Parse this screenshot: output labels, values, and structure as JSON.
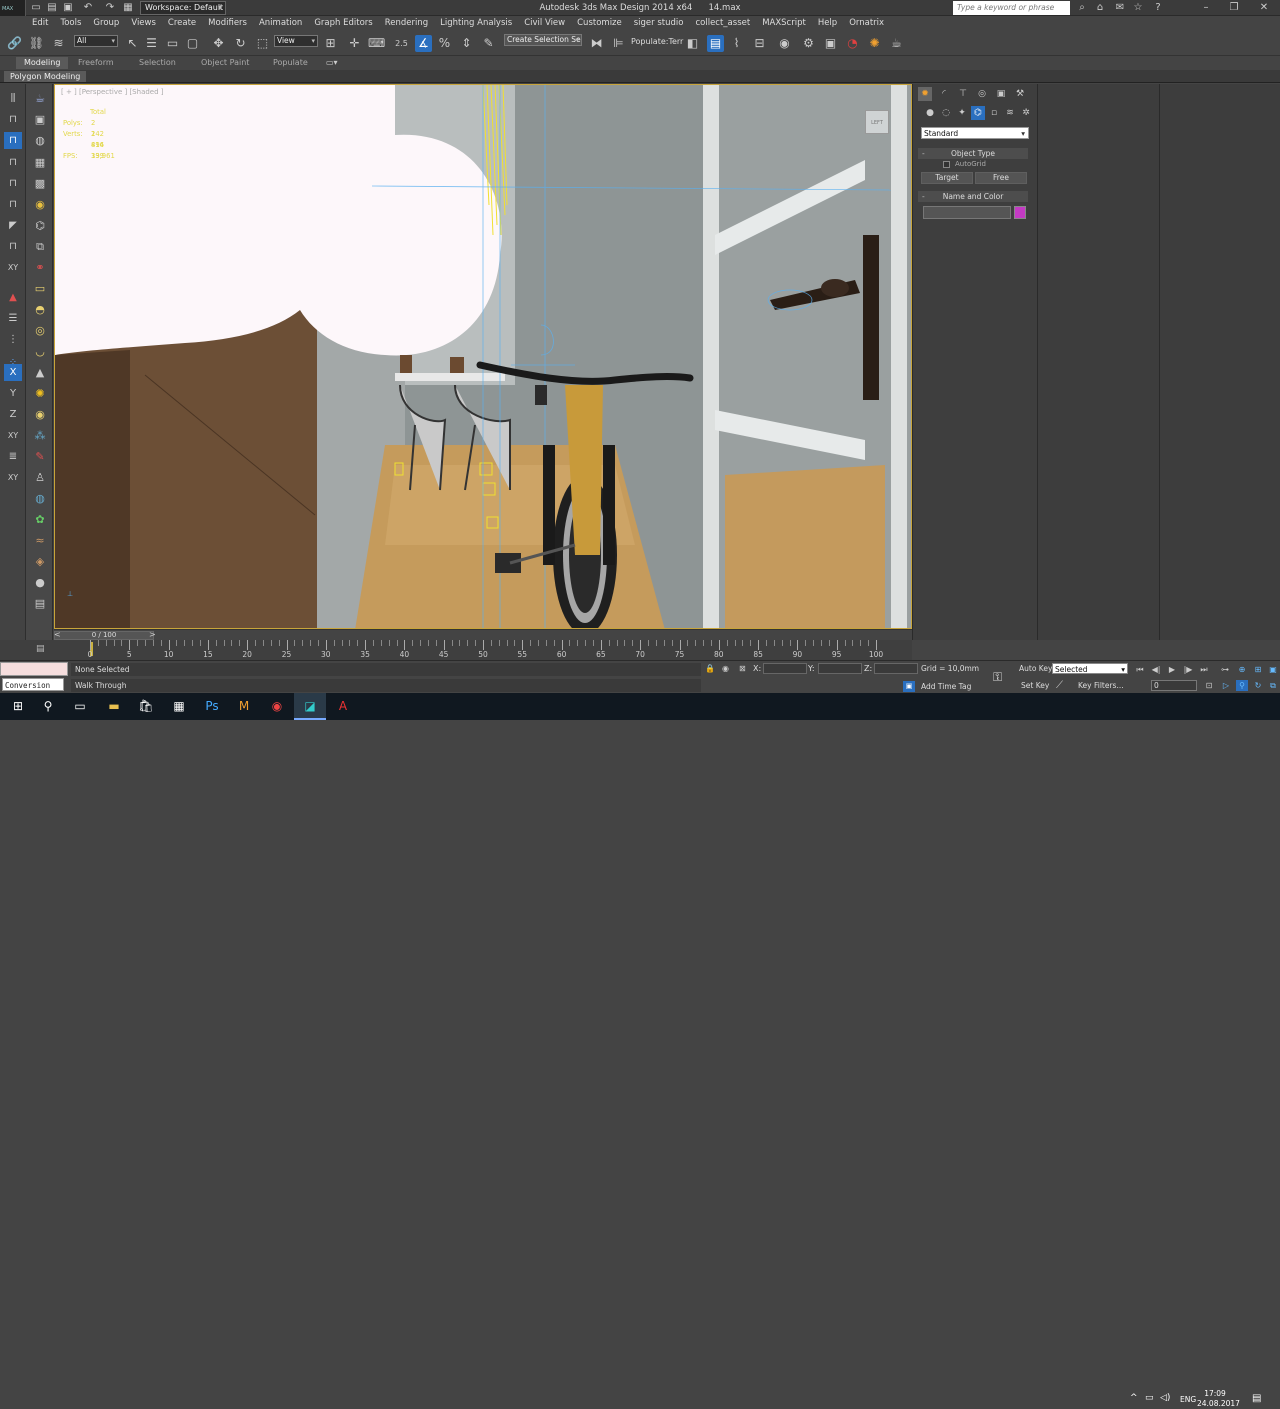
{
  "titlebar": {
    "app_title": "Autodesk 3ds Max Design 2014 x64",
    "file_name": "14.max",
    "workspace": "Workspace: Default",
    "search_placeholder": "Type a keyword or phrase",
    "logo_text": "MAX"
  },
  "menu": [
    "Edit",
    "Tools",
    "Group",
    "Views",
    "Create",
    "Modifiers",
    "Animation",
    "Graph Editors",
    "Rendering",
    "Lighting Analysis",
    "Civil View",
    "Customize",
    "siger studio",
    "collect_asset",
    "MAXScript",
    "Help",
    "Ornatrix"
  ],
  "toolbar": {
    "selection_filter": "All",
    "ref_coord": "View",
    "snap_label": "2.5",
    "named_selection": "Create Selection Se",
    "populate_label": "Populate:Terr"
  },
  "ribbon": {
    "tabs": [
      "Modeling",
      "Freeform",
      "Selection",
      "Object Paint",
      "Populate"
    ],
    "active_tab": "Modeling",
    "panel_label": "Polygon Modeling"
  },
  "left_toolbar_labels": {
    "xy1": "XY",
    "x": "X",
    "y": "Y",
    "z": "Z",
    "xy2": "XY",
    "xy3": "XY"
  },
  "viewport": {
    "label": "[ + ] [Perspective ] [Shaded ]",
    "stats": {
      "header": "Total",
      "polys_label": "Polys:",
      "polys": "2 242 414",
      "verts_label": "Verts:",
      "verts": "1 896 339",
      "fps_label": "FPS:",
      "fps": "19,961"
    },
    "viewcube_label": "LEFT"
  },
  "command_panel": {
    "category": "Standard",
    "object_type_title": "Object Type",
    "autogrid_label": "AutoGrid",
    "buttons": [
      "Target",
      "Free"
    ],
    "name_color_title": "Name and Color",
    "object_color": "#c33ac3"
  },
  "timeline": {
    "frame_display": "0 / 100",
    "labels": [
      "0",
      "5",
      "10",
      "15",
      "20",
      "25",
      "30",
      "35",
      "40",
      "45",
      "50",
      "55",
      "60",
      "65",
      "70",
      "75",
      "80",
      "85",
      "90",
      "95",
      "100"
    ]
  },
  "status": {
    "maxscript_text": "Conversion di",
    "status_text": "None Selected",
    "prompt_text": "Walk Through",
    "x_label": "X:",
    "y_label": "Y:",
    "z_label": "Z:",
    "grid_text": "Grid = 10,0mm",
    "add_time_tag": "Add Time Tag",
    "auto_key": "Auto Key",
    "set_key": "Set Key",
    "key_mode": "Selected",
    "key_filters": "Key Filters...",
    "current_frame": "0"
  },
  "taskbar": {
    "language": "ENG",
    "time": "17:09",
    "date": "24.08.2017"
  }
}
